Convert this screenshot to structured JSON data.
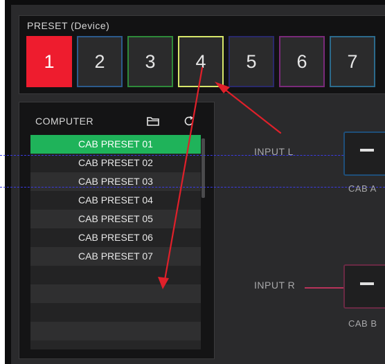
{
  "preset_section": {
    "title": "PRESET (Device)",
    "buttons": [
      "1",
      "2",
      "3",
      "4",
      "5",
      "6",
      "7"
    ],
    "selected": "1",
    "border_colors": [
      "#ee1c2e",
      "#2c5a8c",
      "#2e8a3a",
      "#d8e86a",
      "#29296b",
      "#7a2a7a",
      "#2c6a8c"
    ]
  },
  "computer_panel": {
    "title": "COMPUTER",
    "folder_icon": "folder-icon",
    "refresh_icon": "refresh-icon",
    "presets": [
      "CAB PRESET 01",
      "CAB PRESET 02",
      "CAB PRESET 03",
      "CAB PRESET 04",
      "CAB PRESET 05",
      "CAB PRESET 06",
      "CAB PRESET 07"
    ],
    "active_preset": "CAB PRESET 01"
  },
  "routing": {
    "input_l": "INPUT L",
    "input_r": "INPUT R",
    "cab_a": "CAB A",
    "cab_b": "CAB B"
  },
  "colors": {
    "selected_preset": "#ee1c2e",
    "active_list_item": "#1fb35a",
    "wire_left": "#3b3be6",
    "wire_right": "#b8335a",
    "annotation_arrow": "#e0202a"
  }
}
